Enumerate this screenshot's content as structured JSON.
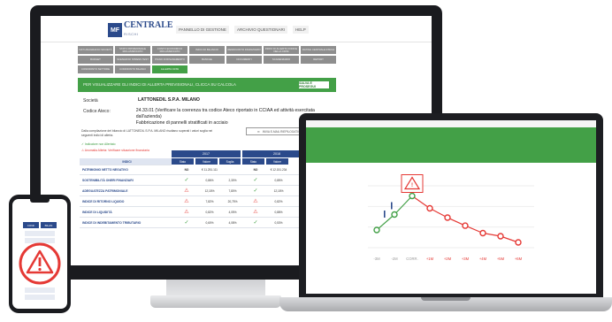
{
  "brand": {
    "logo_mark": "MF",
    "logo_name": "CENTRALE",
    "logo_sub": "RISCHI"
  },
  "topnav": [
    "PANNELLO DI GESTIONE",
    "ARCHIVIO QUESTIONARI",
    "HELP"
  ],
  "menu": {
    "rows": [
      [
        {
          "label": "DATI ANAGRAFICI SOCIETÀ",
          "active": false
        },
        {
          "label": "STATO PATRIMONIALE RICLASSIFICATO",
          "active": false
        },
        {
          "label": "CONTO ECONOMICO RICLASSIFICATO",
          "active": false
        },
        {
          "label": "INDICI DI BILANCIO",
          "active": false
        },
        {
          "label": "RENDICONTO FINANZIARIO",
          "active": false
        },
        {
          "label": "INDICI DI ALLERTA CODICE DELLA CRISI",
          "active": false
        },
        {
          "label": "RATING CENTRALE RISCHI",
          "active": false
        }
      ],
      [
        {
          "label": "BUDGET",
          "active": false
        },
        {
          "label": "SCENARI DI STRESS TEST",
          "active": false
        },
        {
          "label": "PIANO DI RISANAMENTO",
          "active": false
        },
        {
          "label": "BANCHE",
          "active": false
        },
        {
          "label": "DOCUMENTI",
          "active": false
        },
        {
          "label": "SCADENZARIO",
          "active": false
        },
        {
          "label": "REPORT",
          "active": false
        }
      ],
      [
        {
          "label": "CONFRONTO SETTORE",
          "active": false
        },
        {
          "label": "CONFRONTO BILANCI",
          "active": false
        },
        {
          "label": "ALLERTA CRISI",
          "active": true
        }
      ]
    ]
  },
  "banner": {
    "text": "PER VISUALIZZARE GLI INDICI DI ALLERTA PREVISIONALI, CLICCA SU CALCOLA",
    "button": "SALVA E PROSEGUI"
  },
  "company": {
    "label_company": "Società",
    "company_name": "LATTONEDIL S.P.A. MILANO",
    "label_ateco": "Codice Ateco:",
    "ateco_line1": "24.33.01 (Verificare la coerenza tra codice Ateco riportato in CCIAA ed attività esercitata dall'azienda)",
    "ateco_line2": "Fabbricazione di pannelli stratificati in acciaio"
  },
  "note": "Dalla compilazione del bilancio di LATTONEDIL S.P.A. MILANO risultano superati i valori soglia nei seguenti indici di allerta.",
  "mail_button": "INVIA E-MAIL RIEPILOGATIVA",
  "legend": {
    "ok": "✓  Indicatore non Allertato",
    "warn": "⚠  Anomalia Allerta: Verificare situazione finanziaria"
  },
  "table": {
    "group_headers": [
      "2017",
      "2018"
    ],
    "sub_headers": [
      "Stato",
      "Valore",
      "Soglia",
      "Stato",
      "Valore"
    ],
    "label_header": "INDICI",
    "rows": [
      {
        "label": "PATRIMONIO NETTO NEGATIVO",
        "s1": "NO",
        "v1": "€ 11.251.111",
        "g1": "",
        "s2": "NO",
        "v2": "€ 12.151.234"
      },
      {
        "label": "SOSTENIBILITÀ ONERI FINANZIARI",
        "s1": "ok",
        "v1": "0,86%",
        "g1": "2,30%",
        "s2": "ok",
        "v2": "0,85%"
      },
      {
        "label": "ADEGUATEZZA PATRIMONIALE",
        "s1": "warn",
        "v1": "12,18%",
        "g1": "7,80%",
        "s2": "ok",
        "v2": "12,18%"
      },
      {
        "label": "INDICE DI RITORNO LIQUIDO",
        "s1": "warn",
        "v1": "7,82%",
        "g1": "20,75%",
        "s2": "warn",
        "v2": "0,82%"
      },
      {
        "label": "INDICE DI LIQUIDITÀ",
        "s1": "warn",
        "v1": "0,82%",
        "g1": "4,05%",
        "s2": "warn",
        "v2": "0,88%"
      },
      {
        "label": "INDICE DI INDEBITAMENTO TRIBUTARIO",
        "s1": "ok",
        "v1": "0,60%",
        "g1": "4,08%",
        "s2": "ok",
        "v2": "0,53%"
      }
    ]
  },
  "laptop_chart": {
    "type": "line",
    "x": [
      "-3M",
      "-2M",
      "CORR.",
      "+1M",
      "+2M",
      "+3M",
      "+4M",
      "+5M",
      "+6M"
    ],
    "y": [
      0.2,
      0.45,
      0.75,
      0.55,
      0.4,
      0.27,
      0.15,
      0.1,
      0.0
    ],
    "ok_indices": [
      0,
      1,
      2
    ],
    "colors": {
      "ok": "#43a047",
      "warn": "#e53935",
      "neutral": "#2b4a8b"
    }
  },
  "phone": {
    "chip_left": "CONF",
    "chip_right": "BILAN"
  }
}
